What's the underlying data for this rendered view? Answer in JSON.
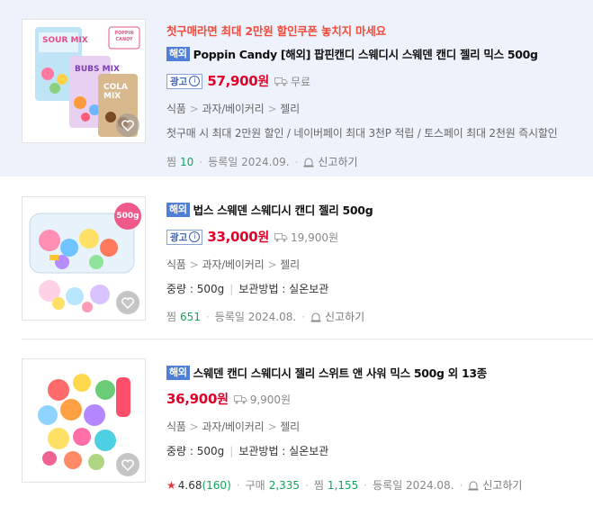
{
  "products": [
    {
      "promo": "첫구매라면 최대 2만원 할인쿠폰 놓치지 마세요",
      "badge": "해외",
      "title": "Poppin Candy [해외] 팝핀캔디 스웨디시 스웨덴 캔디 젤리 믹스 500g",
      "ad": "광고",
      "price": "57,900",
      "won": "원",
      "shipping": "무료",
      "category": [
        "식품",
        "과자/베이커리",
        "젤리"
      ],
      "benefit": "첫구매 시 최대 2만원 할인 / 네이버페이 최대 3천P 적립 / 토스페이 최대 2천원 즉시할인",
      "zzim_label": "찜",
      "zzim_count": "10",
      "registered": "등록일 2024.09.",
      "report": "신고하기",
      "thumb_text": [
        "SOUR MIX",
        "BUBS MIX",
        "COLA MIX",
        "POPPIN CANDY"
      ]
    },
    {
      "badge": "해외",
      "title": "법스 스웨덴 스웨디시 캔디 젤리 500g",
      "ad": "광고",
      "price": "33,000",
      "won": "원",
      "shipping": "19,900원",
      "category": [
        "식품",
        "과자/베이커리",
        "젤리"
      ],
      "weight_label": "중량 : 500g",
      "storage_label": "보관방법 : 실온보관",
      "zzim_label": "찜",
      "zzim_count": "651",
      "registered": "등록일 2024.08.",
      "report": "신고하기",
      "thumb_tag": "500g"
    },
    {
      "badge": "해외",
      "title": "스웨덴 캔디 스웨디시 젤리 스위트 앤 사워 믹스 500g 외 13종",
      "price": "36,900",
      "won": "원",
      "shipping": "9,900원",
      "category": [
        "식품",
        "과자/베이커리",
        "젤리"
      ],
      "weight_label": "중량 : 500g",
      "storage_label": "보관방법 : 실온보관",
      "rating": "4.68",
      "rating_count": "(160)",
      "purchase_label": "구매",
      "purchase_count": "2,335",
      "zzim_label": "찜",
      "zzim_count": "1,155",
      "registered": "등록일 2024.08.",
      "report": "신고하기"
    }
  ],
  "colors": {
    "price": "#e0002a",
    "promo": "#f04b3c",
    "badge": "#4f7fd6",
    "count": "#11a55a"
  }
}
